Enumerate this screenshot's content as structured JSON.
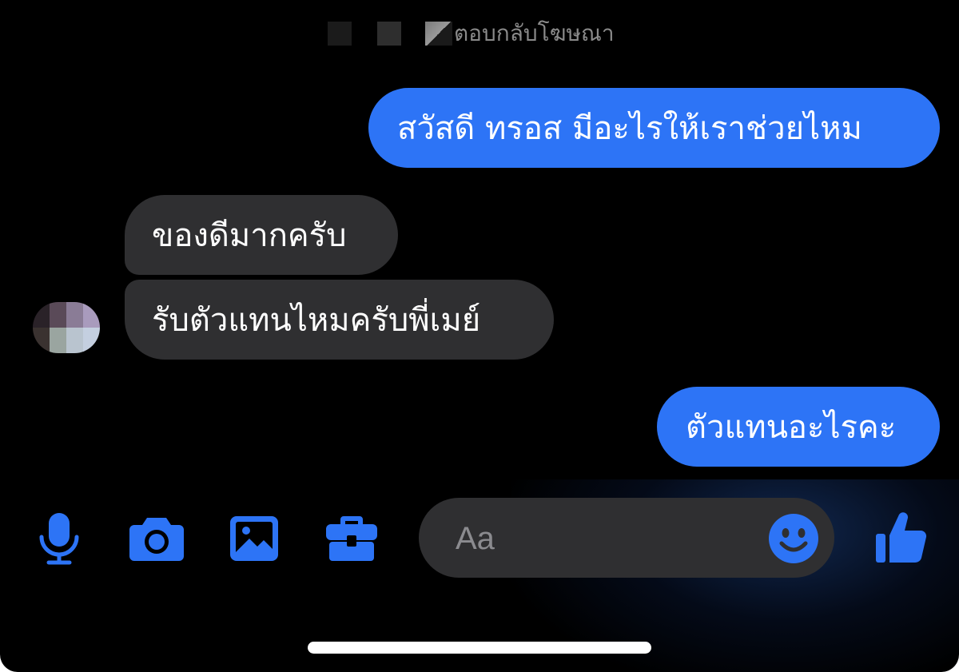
{
  "thread": {
    "reply_note": "ตอบกลับโฆษณา",
    "messages": [
      {
        "sender": "me",
        "text": "สวัสดี ทรอส มีอะไรให้เราช่วยไหม"
      },
      {
        "sender": "contact",
        "text": "ของดีมากครับ"
      },
      {
        "sender": "contact",
        "text": "รับตัวแทนไหมครับพี่เมย์"
      },
      {
        "sender": "me",
        "text": "ตัวแทนอะไรคะ"
      }
    ]
  },
  "composer": {
    "placeholder": "Aa",
    "value": ""
  },
  "toolbar": {
    "icons": [
      "microphone-icon",
      "camera-icon",
      "image-icon",
      "briefcase-icon",
      "emoji-icon",
      "thumbs-up-icon"
    ]
  },
  "colors": {
    "accent": "#2d74f6",
    "incoming_bubble": "#2f2f31",
    "background": "#000000",
    "muted_text": "#8a8a8a"
  }
}
